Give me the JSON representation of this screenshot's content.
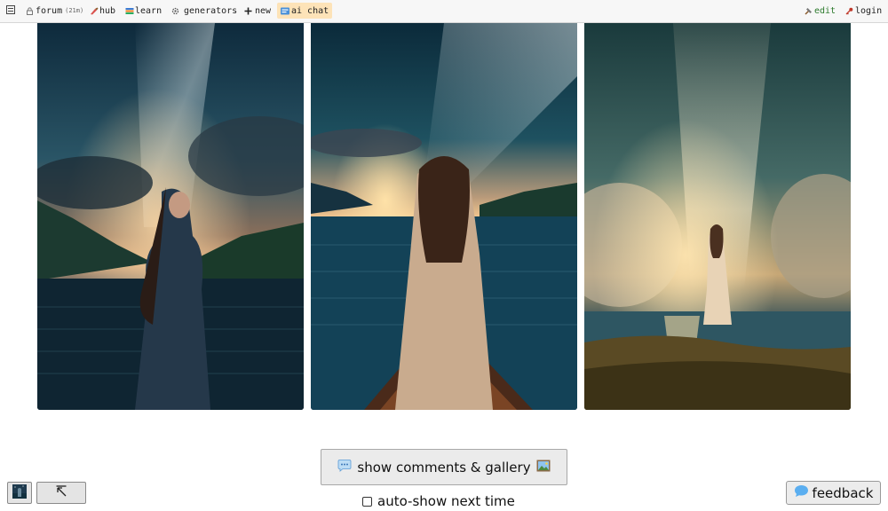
{
  "nav": {
    "forum_label": "forum",
    "forum_badge": "(21m)",
    "hub_label": "hub",
    "learn_label": "learn",
    "generators_label": "generators",
    "new_label": "new",
    "ai_chat_label": "ai chat",
    "edit_label": "edit",
    "login_label": "login"
  },
  "colors": {
    "accent_tab": "#fde3b8",
    "edit_green": "#2c7a2c",
    "login_red": "#c0392b"
  },
  "gallery": {
    "images": [
      {
        "subject": "woman by starlit mountain lake, side profile"
      },
      {
        "subject": "woman in boat facing starlit lake, back view"
      },
      {
        "subject": "woman standing on shore under milky way clouds"
      }
    ]
  },
  "controls": {
    "show_comments_label": "show comments & gallery",
    "autoshow_label": "auto-show next time",
    "autoshow_checked": false,
    "feedback_label": "feedback"
  }
}
